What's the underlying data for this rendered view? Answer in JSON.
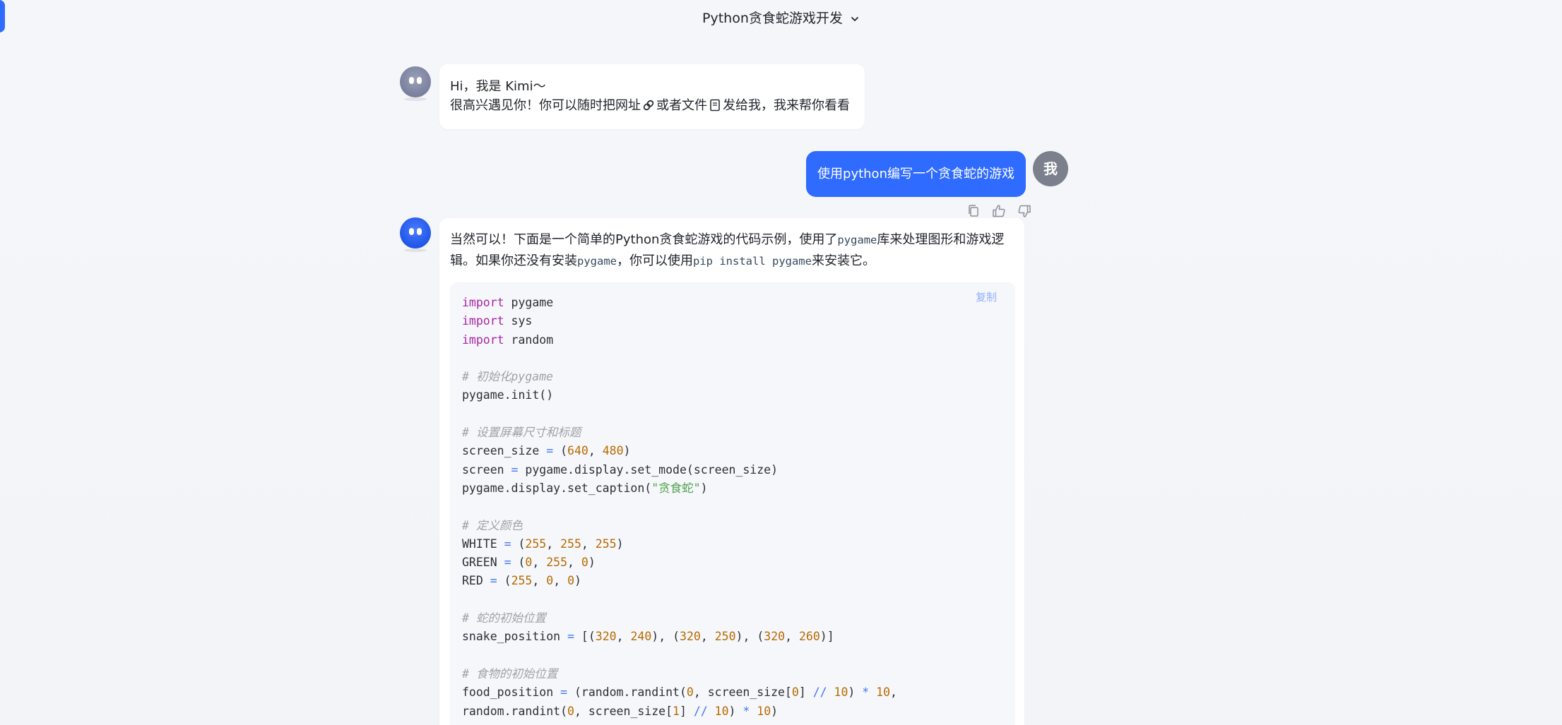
{
  "header": {
    "title": "Python贪食蛇游戏开发"
  },
  "greeting": {
    "line1": "Hi，我是 Kimi～",
    "line2_part1": "很高兴遇见你！你可以随时把网址",
    "line2_part2": "或者文件",
    "line2_part3": "发给我，我来帮你看看"
  },
  "user_message": {
    "text": "使用python编写一个贪食蛇的游戏",
    "avatar_label": "我"
  },
  "answer": {
    "p1": "当然可以！下面是一个简单的Python贪食蛇游戏的代码示例，使用了",
    "p1_code": "pygame",
    "p2": "库来处理图形和游戏逻辑。如果你还没有安装",
    "p2_code": "pygame",
    "p3": "，你可以使用",
    "p3_code": "pip install pygame",
    "p4": "来安装它。"
  },
  "code": {
    "copy_label": "复制",
    "lines": [
      [
        {
          "t": "import",
          "c": "kw"
        },
        {
          "t": " pygame",
          "c": "plain"
        }
      ],
      [
        {
          "t": "import",
          "c": "kw"
        },
        {
          "t": " sys",
          "c": "plain"
        }
      ],
      [
        {
          "t": "import",
          "c": "kw"
        },
        {
          "t": " random",
          "c": "plain"
        }
      ],
      [],
      [
        {
          "t": "# 初始化pygame",
          "c": "com"
        }
      ],
      [
        {
          "t": "pygame.init()",
          "c": "plain"
        }
      ],
      [],
      [
        {
          "t": "# 设置屏幕尺寸和标题",
          "c": "com"
        }
      ],
      [
        {
          "t": "screen_size ",
          "c": "plain"
        },
        {
          "t": "=",
          "c": "op"
        },
        {
          "t": " (",
          "c": "plain"
        },
        {
          "t": "640",
          "c": "num"
        },
        {
          "t": ", ",
          "c": "plain"
        },
        {
          "t": "480",
          "c": "num"
        },
        {
          "t": ")",
          "c": "plain"
        }
      ],
      [
        {
          "t": "screen ",
          "c": "plain"
        },
        {
          "t": "=",
          "c": "op"
        },
        {
          "t": " pygame.display.set_mode(screen_size)",
          "c": "plain"
        }
      ],
      [
        {
          "t": "pygame.display.set_caption(",
          "c": "plain"
        },
        {
          "t": "\"贪食蛇\"",
          "c": "str"
        },
        {
          "t": ")",
          "c": "plain"
        }
      ],
      [],
      [
        {
          "t": "# 定义颜色",
          "c": "com"
        }
      ],
      [
        {
          "t": "WHITE ",
          "c": "plain"
        },
        {
          "t": "=",
          "c": "op"
        },
        {
          "t": " (",
          "c": "plain"
        },
        {
          "t": "255",
          "c": "num"
        },
        {
          "t": ", ",
          "c": "plain"
        },
        {
          "t": "255",
          "c": "num"
        },
        {
          "t": ", ",
          "c": "plain"
        },
        {
          "t": "255",
          "c": "num"
        },
        {
          "t": ")",
          "c": "plain"
        }
      ],
      [
        {
          "t": "GREEN ",
          "c": "plain"
        },
        {
          "t": "=",
          "c": "op"
        },
        {
          "t": " (",
          "c": "plain"
        },
        {
          "t": "0",
          "c": "num"
        },
        {
          "t": ", ",
          "c": "plain"
        },
        {
          "t": "255",
          "c": "num"
        },
        {
          "t": ", ",
          "c": "plain"
        },
        {
          "t": "0",
          "c": "num"
        },
        {
          "t": ")",
          "c": "plain"
        }
      ],
      [
        {
          "t": "RED ",
          "c": "plain"
        },
        {
          "t": "=",
          "c": "op"
        },
        {
          "t": " (",
          "c": "plain"
        },
        {
          "t": "255",
          "c": "num"
        },
        {
          "t": ", ",
          "c": "plain"
        },
        {
          "t": "0",
          "c": "num"
        },
        {
          "t": ", ",
          "c": "plain"
        },
        {
          "t": "0",
          "c": "num"
        },
        {
          "t": ")",
          "c": "plain"
        }
      ],
      [],
      [
        {
          "t": "# 蛇的初始位置",
          "c": "com"
        }
      ],
      [
        {
          "t": "snake_position ",
          "c": "plain"
        },
        {
          "t": "=",
          "c": "op"
        },
        {
          "t": " [(",
          "c": "plain"
        },
        {
          "t": "320",
          "c": "num"
        },
        {
          "t": ", ",
          "c": "plain"
        },
        {
          "t": "240",
          "c": "num"
        },
        {
          "t": "), (",
          "c": "plain"
        },
        {
          "t": "320",
          "c": "num"
        },
        {
          "t": ", ",
          "c": "plain"
        },
        {
          "t": "250",
          "c": "num"
        },
        {
          "t": "), (",
          "c": "plain"
        },
        {
          "t": "320",
          "c": "num"
        },
        {
          "t": ", ",
          "c": "plain"
        },
        {
          "t": "260",
          "c": "num"
        },
        {
          "t": ")]",
          "c": "plain"
        }
      ],
      [],
      [
        {
          "t": "# 食物的初始位置",
          "c": "com"
        }
      ],
      [
        {
          "t": "food_position ",
          "c": "plain"
        },
        {
          "t": "=",
          "c": "op"
        },
        {
          "t": " (random.randint(",
          "c": "plain"
        },
        {
          "t": "0",
          "c": "num"
        },
        {
          "t": ", screen_size[",
          "c": "plain"
        },
        {
          "t": "0",
          "c": "num"
        },
        {
          "t": "] ",
          "c": "plain"
        },
        {
          "t": "//",
          "c": "op"
        },
        {
          "t": " ",
          "c": "plain"
        },
        {
          "t": "10",
          "c": "num"
        },
        {
          "t": ") ",
          "c": "plain"
        },
        {
          "t": "*",
          "c": "op"
        },
        {
          "t": " ",
          "c": "plain"
        },
        {
          "t": "10",
          "c": "num"
        },
        {
          "t": ",",
          "c": "plain"
        }
      ],
      [
        {
          "t": "random.randint(",
          "c": "plain"
        },
        {
          "t": "0",
          "c": "num"
        },
        {
          "t": ", screen_size[",
          "c": "plain"
        },
        {
          "t": "1",
          "c": "num"
        },
        {
          "t": "] ",
          "c": "plain"
        },
        {
          "t": "//",
          "c": "op"
        },
        {
          "t": " ",
          "c": "plain"
        },
        {
          "t": "10",
          "c": "num"
        },
        {
          "t": ") ",
          "c": "plain"
        },
        {
          "t": "*",
          "c": "op"
        },
        {
          "t": " ",
          "c": "plain"
        },
        {
          "t": "10",
          "c": "num"
        },
        {
          "t": ")",
          "c": "plain"
        }
      ]
    ]
  },
  "icons": {
    "title_chevron": "chevron-down-icon",
    "link": "link-icon",
    "file": "file-icon",
    "copy": "copy-icon",
    "like": "thumbs-up-icon",
    "dislike": "thumbs-down-icon"
  },
  "colors": {
    "accent": "#2f6bff",
    "user_avatar": "#7c7f8c",
    "page_bg": "#f3f5f9"
  }
}
